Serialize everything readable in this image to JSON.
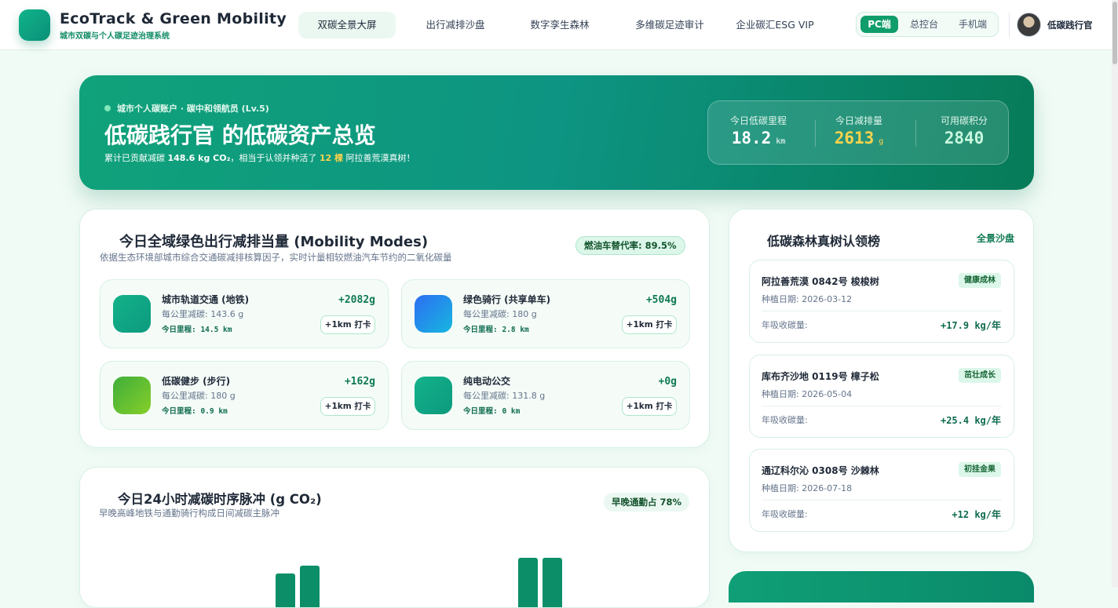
{
  "header": {
    "brand_title": "EcoTrack & Green Mobility",
    "brand_subtitle": "城市双碳与个人碳足迹治理系统",
    "nav": [
      {
        "label": "双碳全景大屏",
        "active": true
      },
      {
        "label": "出行减排沙盘",
        "active": false
      },
      {
        "label": "数字孪生森林",
        "active": false
      },
      {
        "label": "多维碳足迹审计",
        "active": false
      },
      {
        "label": "企业碳汇ESG VIP",
        "active": false
      }
    ],
    "modes": [
      {
        "label": "PC端",
        "active": true
      },
      {
        "label": "总控台",
        "active": false
      },
      {
        "label": "手机端",
        "active": false
      }
    ],
    "username": "低碳践行官"
  },
  "hero": {
    "tag": "城市个人碳账户 · 碳中和领航员 (Lv.5)",
    "title": "低碳践行官 的低碳资产总览",
    "desc_prefix": "累计已贡献减碳",
    "desc_amount": "148.6 kg CO₂",
    "desc_mid": "，相当于认领并种活了",
    "desc_trees": "12 棵",
    "desc_suffix": "阿拉善荒漠真树！",
    "stats": [
      {
        "label": "今日低碳里程",
        "value": "18.2",
        "unit": "km"
      },
      {
        "label": "今日减排量",
        "value": "2613",
        "unit": "g"
      },
      {
        "label": "可用碳积分",
        "value": "2840",
        "unit": ""
      }
    ]
  },
  "mobility": {
    "title": "今日全域绿色出行减排当量 (Mobility Modes)",
    "subtitle": "依据生态环境部城市综合交通碳减排核算因子，实时计量相较燃油汽车节约的二氧化碳量",
    "badge": "燃油车替代率: 89.5%",
    "modes": [
      {
        "name": "城市轨道交通 (地铁)",
        "rate": "每公里减碳: 143.6 g",
        "distance": "今日里程: 14.5 km",
        "gain": "+2082g",
        "button": "+1km 打卡",
        "icon": "metro-icon",
        "color_from": "#13b28a",
        "color_to": "#0c9a7e"
      },
      {
        "name": "绿色骑行 (共享单车)",
        "rate": "每公里减碳: 180 g",
        "distance": "今日里程: 2.8 km",
        "gain": "+504g",
        "button": "+1km 打卡",
        "icon": "bike-icon",
        "color_from": "#2d6ef2",
        "color_to": "#16b7e0"
      },
      {
        "name": "低碳健步 (步行)",
        "rate": "每公里减碳: 180 g",
        "distance": "今日里程: 0.9 km",
        "gain": "+162g",
        "button": "+1km 打卡",
        "icon": "walk-icon",
        "color_from": "#3fae3a",
        "color_to": "#86cf2a"
      },
      {
        "name": "纯电动公交",
        "rate": "每公里减碳: 131.8 g",
        "distance": "今日里程: 0 km",
        "gain": "+0g",
        "button": "+1km 打卡",
        "icon": "bus-icon",
        "color_from": "#13b28a",
        "color_to": "#0c9a7e"
      }
    ]
  },
  "pulse": {
    "title": "今日24小时减碳时序脉冲 (g CO₂)",
    "subtitle": "早晚高峰地铁与通勤骑行构成日间减碳主脉冲",
    "badge": "早晚通勤占 78%"
  },
  "forest": {
    "title": "低碳森林真树认领榜",
    "link": "全景沙盘",
    "trees": [
      {
        "name": "阿拉善荒漠 0842号 梭梭树",
        "date": "种植日期: 2026-03-12",
        "status": "健康成林",
        "absorb_label": "年吸收碳量:",
        "absorb": "+17.9 kg/年"
      },
      {
        "name": "库布齐沙地 0119号 樟子松",
        "date": "种植日期: 2026-05-04",
        "status": "茁壮成长",
        "absorb_label": "年吸收碳量:",
        "absorb": "+25.4 kg/年"
      },
      {
        "name": "通辽科尔沁 0308号 沙棘林",
        "date": "种植日期: 2026-07-18",
        "status": "初挂金果",
        "absorb_label": "年吸收碳量:",
        "absorb": "+12 kg/年"
      }
    ]
  },
  "colors": {
    "accent": "#0f9d6b",
    "brand_dark": "#077b58",
    "gold": "#fcd34d"
  }
}
